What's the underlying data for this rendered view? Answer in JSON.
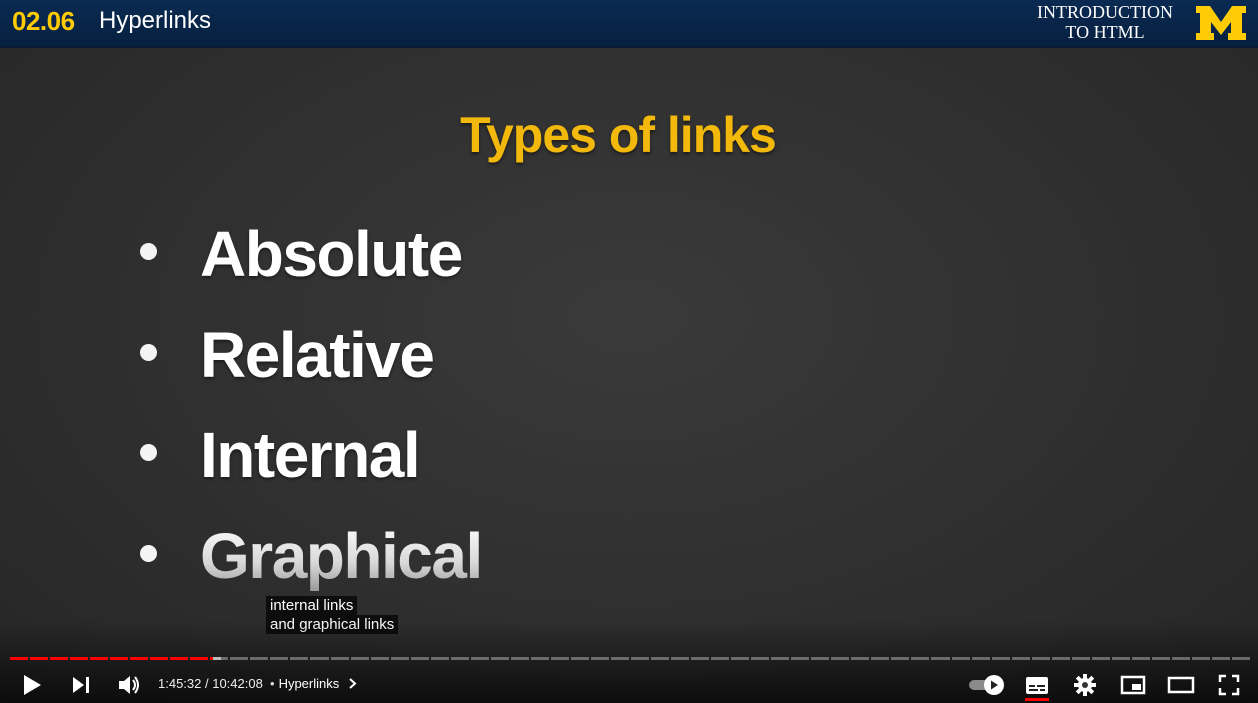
{
  "header": {
    "lesson_number": "02.06",
    "lesson_title": "Hyperlinks",
    "course_line1": "INTRODUCTION",
    "course_line2": "TO HTML",
    "logo_letter": "M"
  },
  "slide": {
    "title": "Types of links",
    "bullets": [
      "Absolute",
      "Relative",
      "Internal",
      "Graphical"
    ]
  },
  "captions": {
    "line1": "internal links",
    "line2": "and graphical links"
  },
  "player": {
    "current_time": "1:45:32",
    "separator": " / ",
    "duration": "10:42:08",
    "chapter_bullet": "•",
    "chapter_title": "Hyperlinks",
    "progress_fraction": 0.164,
    "buffered_fraction": 0.17,
    "icons": [
      "play-icon",
      "next-icon",
      "volume-icon",
      "chevron-right-icon",
      "autoplay-toggle-icon",
      "subtitles-icon",
      "settings-icon",
      "miniplayer-icon",
      "theater-mode-icon",
      "fullscreen-icon"
    ]
  },
  "colors": {
    "accent_yellow": "#f2b90c",
    "maize": "#ffcb05",
    "header_blue": "#0b2a52",
    "progress_red": "#ff0000"
  }
}
